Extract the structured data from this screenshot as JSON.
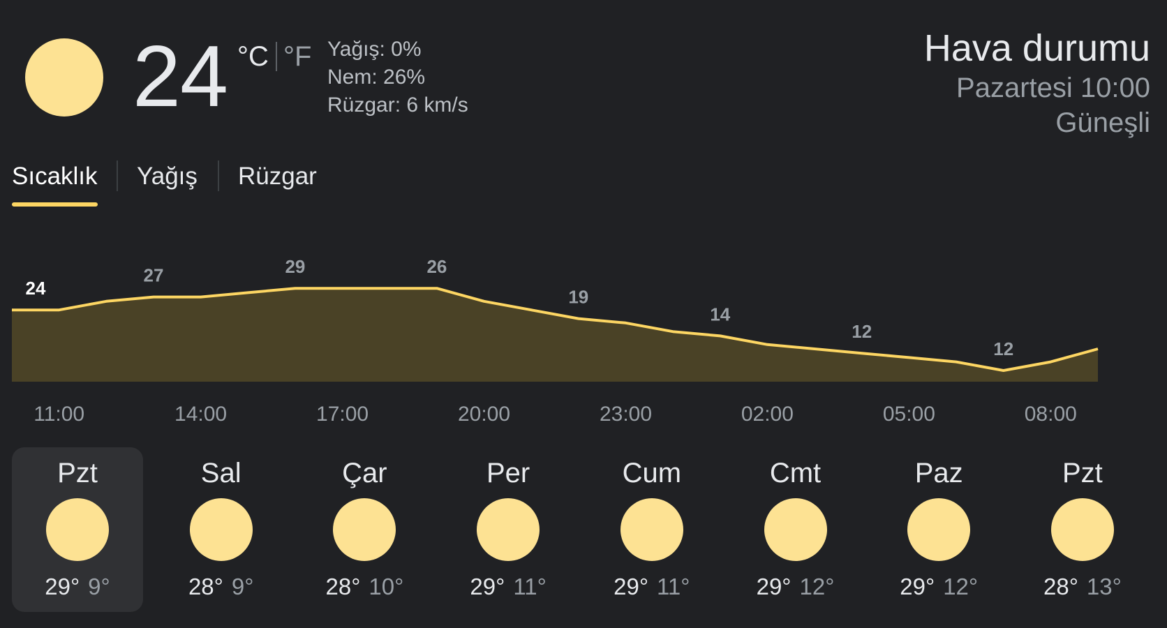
{
  "current": {
    "icon": "sun-icon",
    "temp": "24",
    "unit_c": "°C",
    "unit_f": "°F",
    "precip": "Yağış: 0%",
    "humidity": "Nem: 26%",
    "wind": "Rüzgar: 6 km/s"
  },
  "location": {
    "title": "Hava durumu",
    "time": "Pazartesi 10:00",
    "condition": "Güneşli"
  },
  "tabs": [
    {
      "label": "Sıcaklık",
      "selected": true
    },
    {
      "label": "Yağış",
      "selected": false
    },
    {
      "label": "Rüzgar",
      "selected": false
    }
  ],
  "chart_data": {
    "type": "area",
    "hours": [
      "10:00",
      "11:00",
      "12:00",
      "13:00",
      "14:00",
      "15:00",
      "16:00",
      "17:00",
      "18:00",
      "19:00",
      "20:00",
      "21:00",
      "22:00",
      "23:00",
      "00:00",
      "01:00",
      "02:00",
      "03:00",
      "04:00",
      "05:00",
      "06:00",
      "07:00",
      "08:00",
      "09:00"
    ],
    "values": [
      24,
      24,
      26,
      27,
      27,
      28,
      29,
      29,
      29,
      29,
      26,
      24,
      22,
      21,
      19,
      18,
      16,
      15,
      14,
      13,
      12,
      10,
      12,
      15
    ],
    "value_labels": [
      {
        "hour": "10:00",
        "label": "24"
      },
      {
        "hour": "13:00",
        "label": "27"
      },
      {
        "hour": "16:00",
        "label": "29"
      },
      {
        "hour": "19:00",
        "label": "26"
      },
      {
        "hour": "22:00",
        "label": "19"
      },
      {
        "hour": "01:00",
        "label": "14"
      },
      {
        "hour": "04:00",
        "label": "12"
      },
      {
        "hour": "07:00",
        "label": "12"
      }
    ],
    "tick_labels": [
      "11:00",
      "14:00",
      "17:00",
      "20:00",
      "23:00",
      "02:00",
      "05:00",
      "08:00"
    ],
    "line_color": "#fdd663",
    "fill_color": "#4a4226"
  },
  "days": [
    {
      "name": "Pzt",
      "hi": "29°",
      "lo": "9°",
      "icon": "sun-icon",
      "selected": true
    },
    {
      "name": "Sal",
      "hi": "28°",
      "lo": "9°",
      "icon": "sun-icon",
      "selected": false
    },
    {
      "name": "Çar",
      "hi": "28°",
      "lo": "10°",
      "icon": "sun-icon",
      "selected": false
    },
    {
      "name": "Per",
      "hi": "29°",
      "lo": "11°",
      "icon": "sun-icon",
      "selected": false
    },
    {
      "name": "Cum",
      "hi": "29°",
      "lo": "11°",
      "icon": "sun-icon",
      "selected": false
    },
    {
      "name": "Cmt",
      "hi": "29°",
      "lo": "12°",
      "icon": "sun-icon",
      "selected": false
    },
    {
      "name": "Paz",
      "hi": "29°",
      "lo": "12°",
      "icon": "sun-icon",
      "selected": false
    },
    {
      "name": "Pzt",
      "hi": "28°",
      "lo": "13°",
      "icon": "sun-icon",
      "selected": false
    }
  ],
  "colors": {
    "background": "#202124",
    "accent": "#fdd663",
    "sun": "#fde293",
    "selected_day_bg": "#303134"
  }
}
